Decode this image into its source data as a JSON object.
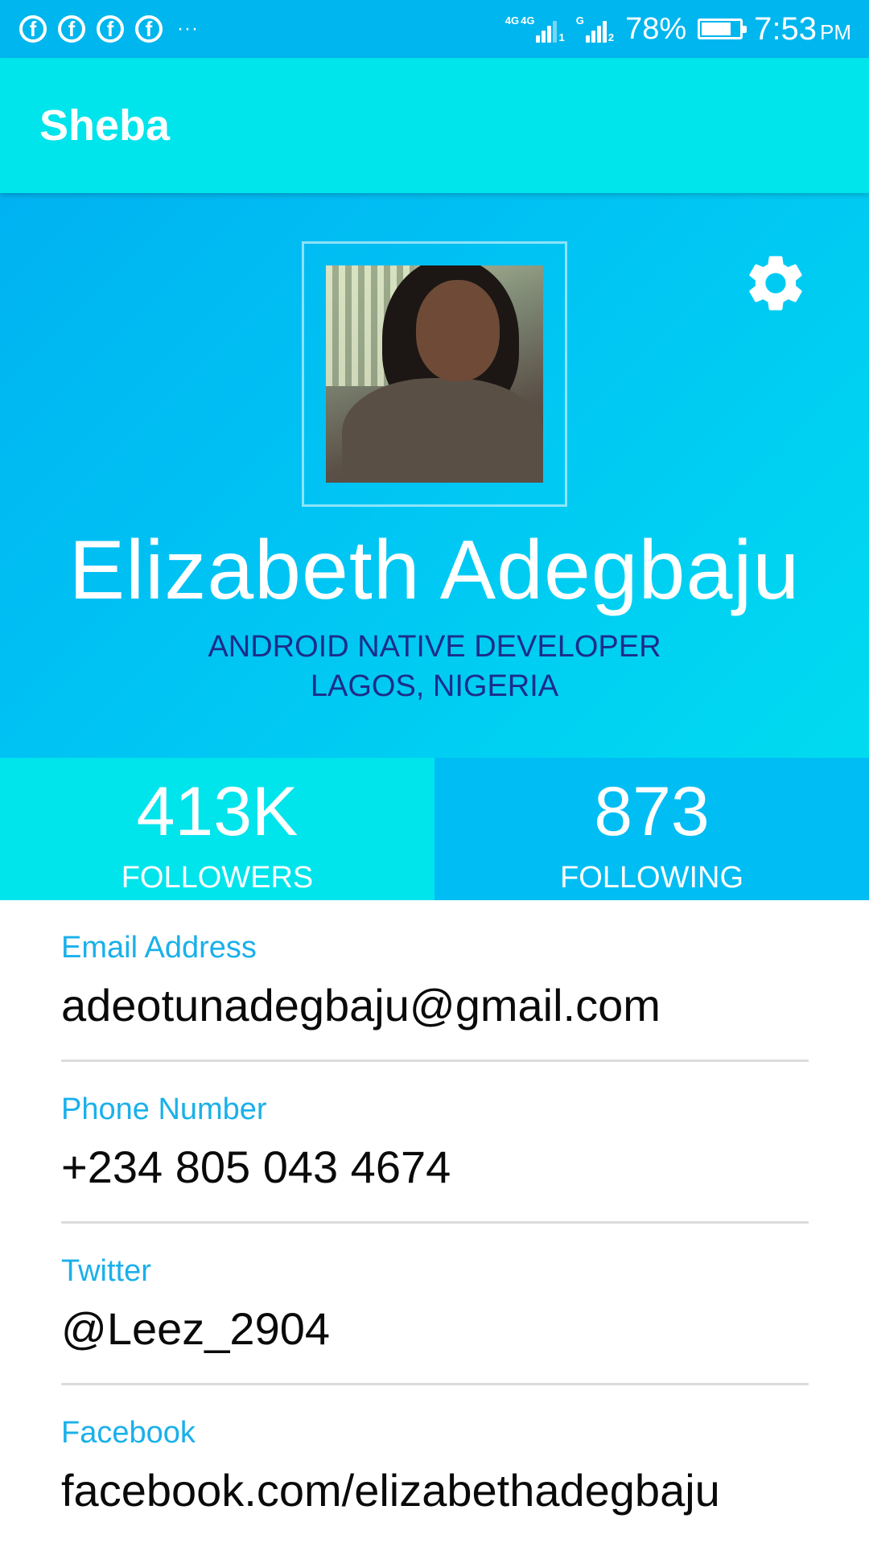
{
  "status_bar": {
    "notification_icons": [
      "facebook-icon",
      "facebook-icon",
      "facebook-icon",
      "facebook-icon"
    ],
    "more": "···",
    "network_1": "4G",
    "network_1b": "4G",
    "sim_1": "1",
    "network_2": "G",
    "sim_2": "2",
    "battery_percent": "78%",
    "battery_level": 0.78,
    "time": "7:53",
    "ampm": "PM"
  },
  "app_bar": {
    "title": "Sheba"
  },
  "profile": {
    "name": "Elizabeth Adegbaju",
    "title": "ANDROID NATIVE DEVELOPER",
    "location": "LAGOS, NIGERIA",
    "settings_icon": "gear-icon"
  },
  "stats": {
    "followers": {
      "value": "413K",
      "label": "FOLLOWERS"
    },
    "following": {
      "value": "873",
      "label": "FOLLOWING"
    }
  },
  "details": [
    {
      "label": "Email Address",
      "value": "adeotunadegbaju@gmail.com"
    },
    {
      "label": "Phone Number",
      "value": "+234 805 043 4674"
    },
    {
      "label": "Twitter",
      "value": "@Leez_2904"
    },
    {
      "label": "Facebook",
      "value": "facebook.com/elizabethadegbaju"
    }
  ],
  "colors": {
    "status_bar": "#00b6ee",
    "app_bar": "#00e4ec",
    "followers_bg": "#00e4ec",
    "following_bg": "#00bdf4",
    "label": "#1ab0ea",
    "subtitle": "#1c2d8a"
  }
}
